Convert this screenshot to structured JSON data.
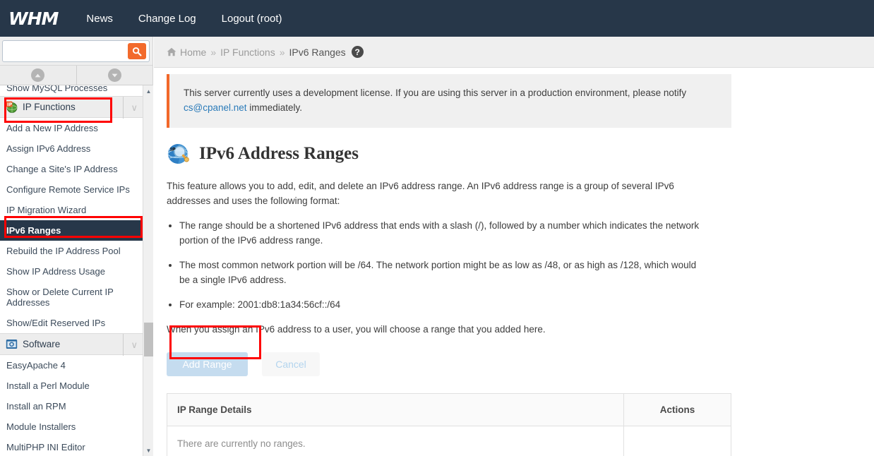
{
  "topnav": {
    "logo": "WHM",
    "links": [
      {
        "label": "News"
      },
      {
        "label": "Change Log"
      },
      {
        "label": "Logout (root)"
      }
    ]
  },
  "sidebar": {
    "search": {
      "value": "",
      "placeholder": ""
    },
    "search_icon": "search-icon",
    "collapse_all_icon": "chevron-up-circle-icon",
    "expand_all_icon": "chevron-down-circle-icon",
    "partial_top_item": "Show MySQL Processes",
    "groups": [
      {
        "label": "IP Functions",
        "icon": "green-globe-icon",
        "chevron": "∨",
        "highlighted": true,
        "items": [
          "Add a New IP Address",
          "Assign IPv6 Address",
          "Change a Site's IP Address",
          "Configure Remote Service IPs",
          "IP Migration Wizard",
          "IPv6 Ranges",
          "Rebuild the IP Address Pool",
          "Show IP Address Usage",
          "Show or Delete Current IP Addresses",
          "Show/Edit Reserved IPs"
        ],
        "active_item": "IPv6 Ranges"
      },
      {
        "label": "Software",
        "icon": "blue-monitor-icon",
        "chevron": "∨",
        "highlighted": false,
        "items": [
          "EasyApache 4",
          "Install a Perl Module",
          "Install an RPM",
          "Module Installers",
          "MultiPHP INI Editor"
        ],
        "active_item": ""
      }
    ],
    "scrollbar": {
      "up_arrow": "▲",
      "down_arrow": "▼"
    }
  },
  "breadcrumb": {
    "home_icon": "home-icon",
    "items": [
      "Home",
      "IP Functions",
      "IPv6 Ranges"
    ],
    "separator": "»",
    "help_icon_label": "?"
  },
  "notice": {
    "text_before_link": "This server currently uses a development license. If you are using this server in a production environment, please notify ",
    "link": "cs@cpanel.net",
    "text_after_link": " immediately."
  },
  "page": {
    "icon": "ip-globe-magnifier-icon",
    "title": "IPv6 Address Ranges",
    "description": "This feature allows you to add, edit, and delete an IPv6 address range. An IPv6 address range is a group of several IPv6 addresses and uses the following format:",
    "bullets": [
      "The range should be a shortened IPv6 address that ends with a slash (/), followed by a number which indicates the network portion of the IPv6 address range.",
      "The most common network portion will be /64. The network portion might be as low as /48, or as high as /128, which would be a single IPv6 address.",
      "For example: 2001:db8:1a34:56cf::/64"
    ],
    "closing": "When you assign an IPv6 address to a user, you will choose a range that you added here."
  },
  "actions": {
    "add_range_label": "Add Range",
    "cancel_label": "Cancel"
  },
  "table": {
    "headers": [
      "IP Range Details",
      "Actions"
    ],
    "rows": [
      {
        "details": "There are currently no ranges.",
        "actions": ""
      }
    ]
  },
  "colors": {
    "navbar": "#273749",
    "accent_orange": "#f26a2c",
    "notice_border": "#f2682a",
    "active_item_bg": "#273749",
    "annotation_red": "#ff0000",
    "button_disabled": "#c5dcef",
    "link_blue": "#2b7bb9"
  }
}
